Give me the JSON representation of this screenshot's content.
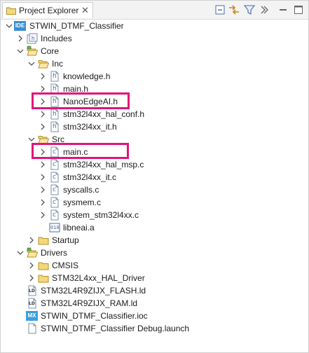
{
  "panel": {
    "tab_label": "Project Explorer",
    "tab_close": "✕",
    "toolbar": {
      "collapse_all": "collapse-all-icon",
      "link_editor": "link-with-editor-icon",
      "filter": "filter-icon",
      "view_menu": "view-menu-icon",
      "minimize": "minimize-icon",
      "maximize": "maximize-icon"
    }
  },
  "tree": {
    "project": "STWIN_DTMF_Classifier",
    "includes": "Includes",
    "core": "Core",
    "inc": "Inc",
    "inc_files": [
      "knowledge.h",
      "main.h",
      "NanoEdgeAI.h",
      "stm32l4xx_hal_conf.h",
      "stm32l4xx_it.h"
    ],
    "src": "Src",
    "src_files": [
      "main.c",
      "stm32l4xx_hal_msp.c",
      "stm32l4xx_it.c",
      "syscalls.c",
      "sysmem.c",
      "system_stm32l4xx.c"
    ],
    "lib_file": "libneai.a",
    "startup": "Startup",
    "drivers": "Drivers",
    "cmsis": "CMSIS",
    "hal_driver": "STM32L4xx_HAL_Driver",
    "flash_ld": "STM32L4R9ZIJX_FLASH.ld",
    "ram_ld": "STM32L4R9ZIJX_RAM.ld",
    "ioc_file": "STWIN_DTMF_Classifier.ioc",
    "launch_file": "STWIN_DTMF_Classifier Debug.launch",
    "icon_text": {
      "ide": "IDE",
      "h": "h",
      "c": "c",
      "lib": "010",
      "ld": "LD",
      "mx": "MX"
    }
  },
  "colors": {
    "highlight": "#e0157a",
    "folder": "#e8c35a",
    "ide_badge": "#3c8fd0",
    "mx_badge": "#3aa0e0"
  }
}
